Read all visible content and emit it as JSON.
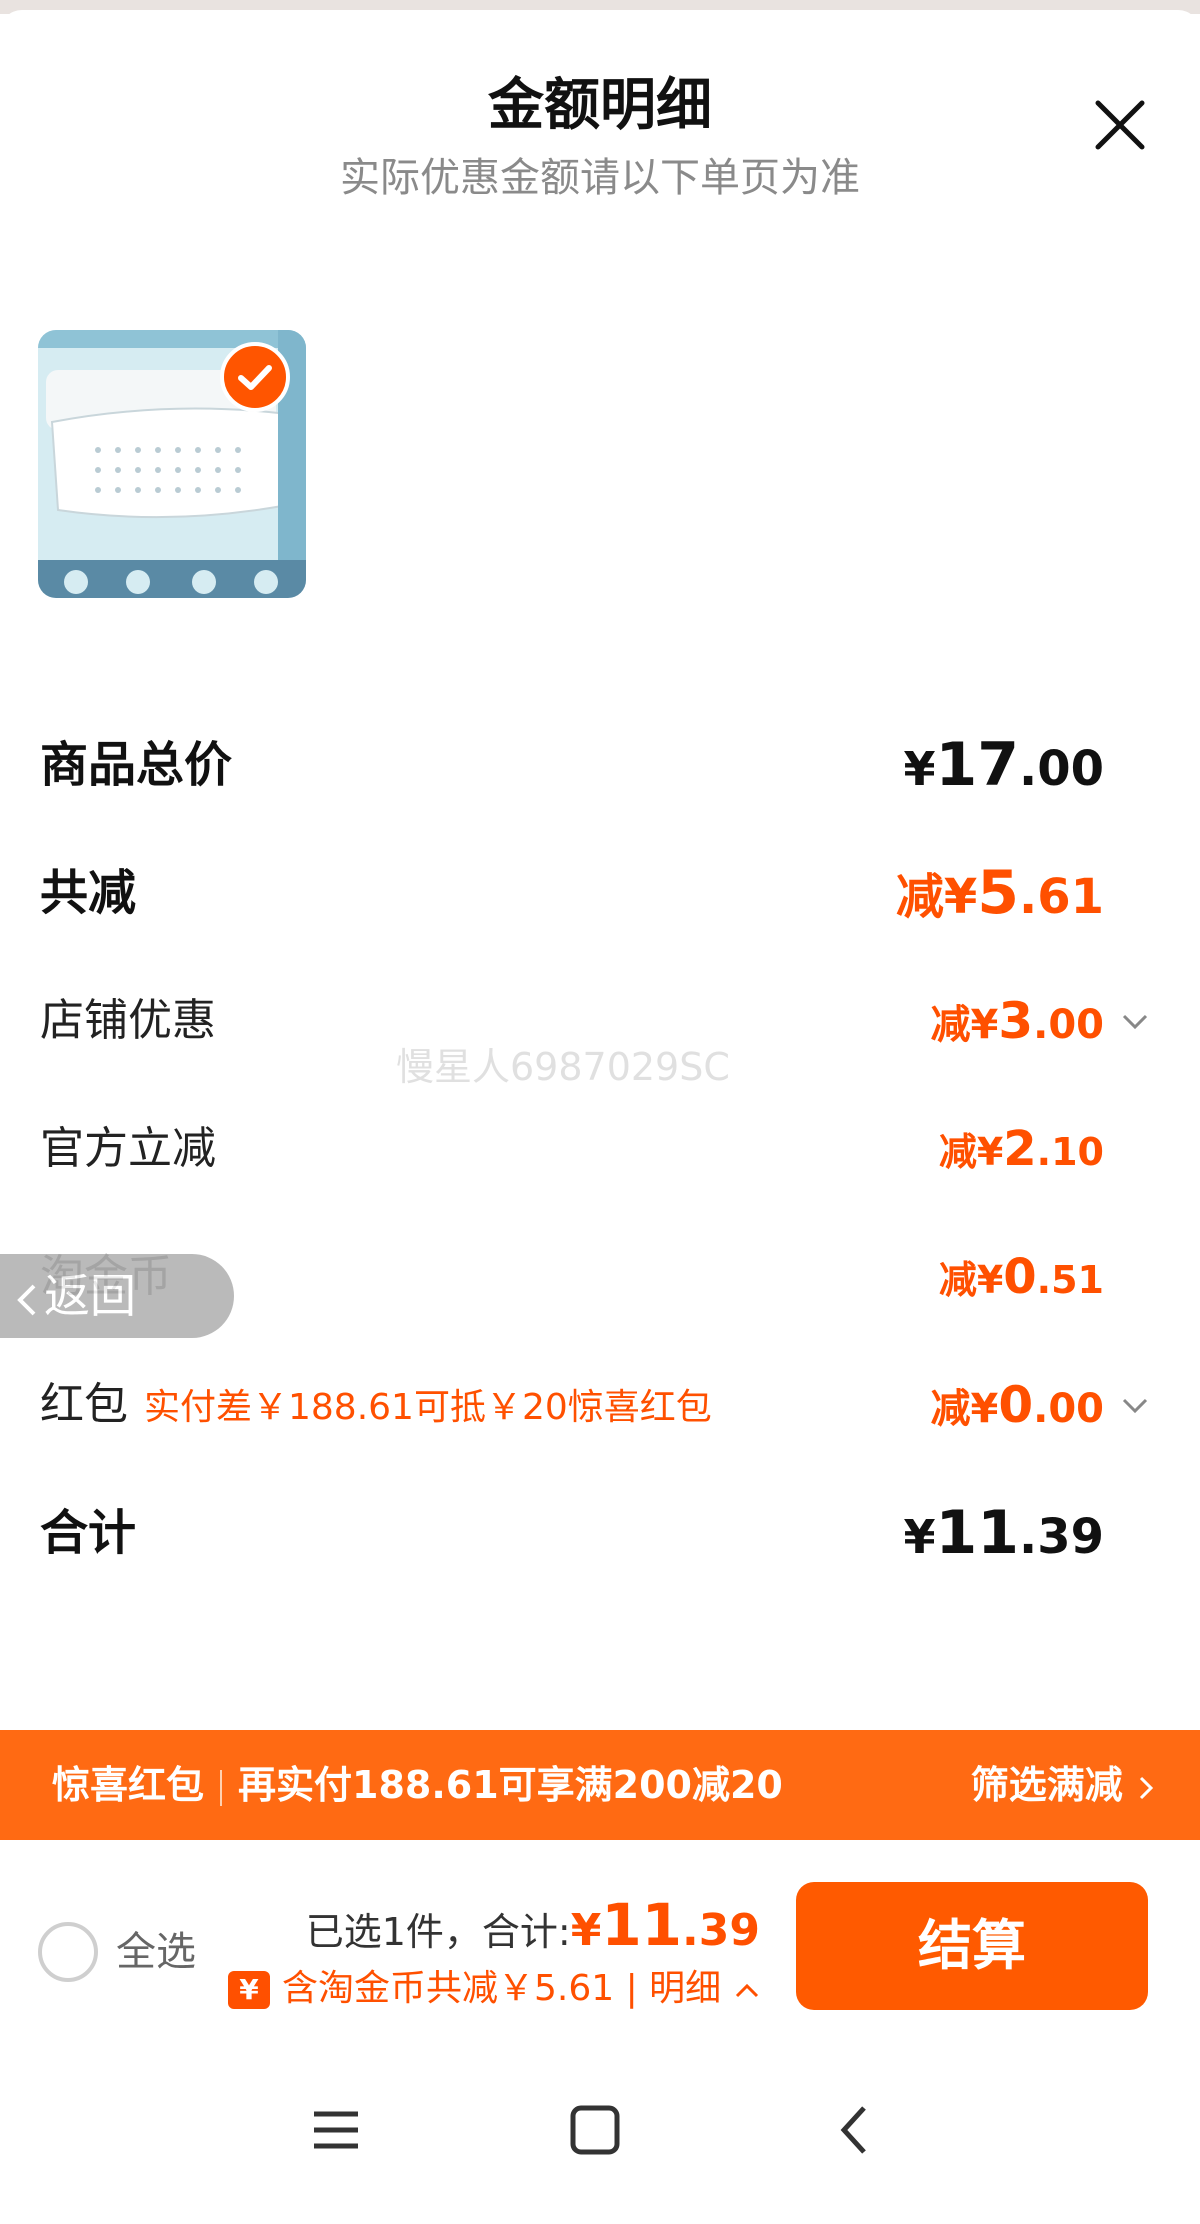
{
  "header": {
    "title": "金额明细",
    "subtitle": "实际优惠金额请以下单页为准",
    "close_icon": "close-icon"
  },
  "product": {
    "selected": true
  },
  "rows": {
    "total_price": {
      "label": "商品总价",
      "currency": "¥",
      "int": "17",
      "dec": ".00"
    },
    "total_reduction": {
      "label": "共减",
      "prefix": "减¥",
      "int": "5",
      "dec": ".61"
    },
    "shop_discount": {
      "label": "店铺优惠",
      "prefix": "减¥",
      "int": "3",
      "dec": ".00"
    },
    "official_discount": {
      "label": "官方立减",
      "prefix": "减¥",
      "int": "2",
      "dec": ".10"
    },
    "tao_coin": {
      "label": "淘金币",
      "prefix": "减¥",
      "int": "0",
      "dec": ".51"
    },
    "red_packet": {
      "label": "红包",
      "hint": "实付差￥188.61可抵￥20惊喜红包",
      "prefix": "减¥",
      "int": "0",
      "dec": ".00"
    },
    "total": {
      "label": "合计",
      "currency": "¥",
      "int": "11",
      "dec": ".39"
    }
  },
  "watermark": "慢星人6987029SC",
  "back_button": {
    "label": "返回"
  },
  "promo_banner": {
    "tag": "惊喜红包",
    "message": "再实付188.61可享满200减20",
    "action": "筛选满减"
  },
  "footer": {
    "select_all_label": "全选",
    "selected_text": "已选1件，合计:",
    "total_currency": "¥",
    "total_int": "11",
    "total_dec": ".39",
    "discount_text": "含淘金币共减￥5.61 | 明细",
    "checkout_label": "结算"
  },
  "colors": {
    "accent": "#ff5000",
    "banner": "#ff6a13",
    "button": "#ff5a00"
  }
}
